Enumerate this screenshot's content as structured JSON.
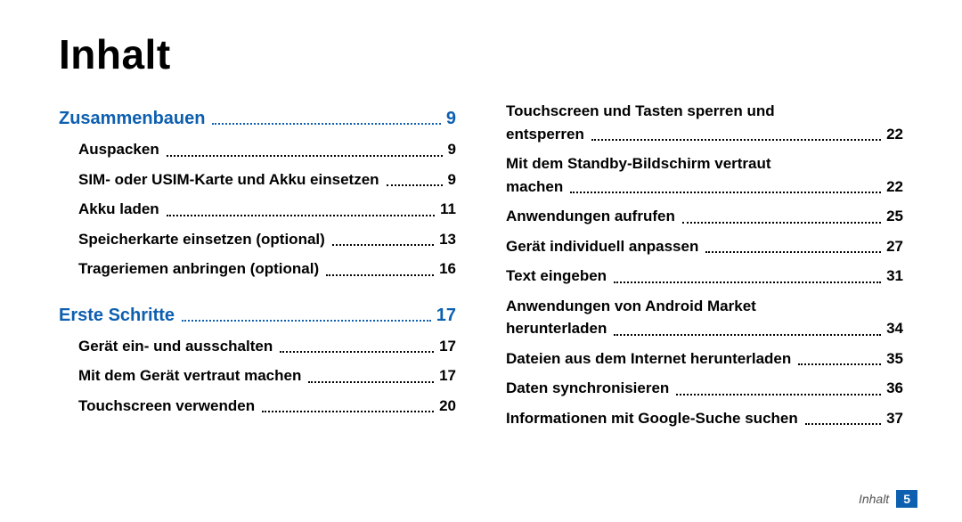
{
  "title": "Inhalt",
  "accent": "#0d5fb0",
  "columns": [
    [
      {
        "type": "section",
        "label": "Zusammenbauen",
        "page": "9"
      },
      {
        "type": "entry",
        "label": "Auspacken",
        "page": "9"
      },
      {
        "type": "entry",
        "label": "SIM- oder USIM-Karte und Akku einsetzen",
        "page": "9"
      },
      {
        "type": "entry",
        "label": "Akku laden",
        "page": "11"
      },
      {
        "type": "entry",
        "label": "Speicherkarte einsetzen (optional)",
        "page": "13"
      },
      {
        "type": "entry",
        "label": "Trageriemen anbringen (optional)",
        "page": "16"
      },
      {
        "type": "section",
        "label": "Erste Schritte",
        "page": "17"
      },
      {
        "type": "entry",
        "label": "Gerät ein- und ausschalten",
        "page": "17"
      },
      {
        "type": "entry",
        "label": "Mit dem Gerät vertraut machen",
        "page": "17"
      },
      {
        "type": "entry",
        "label": "Touchscreen verwenden",
        "page": "20"
      }
    ],
    [
      {
        "type": "entry",
        "lines": [
          "Touchscreen und Tasten sperren und",
          "entsperren"
        ],
        "page": "22"
      },
      {
        "type": "entry",
        "lines": [
          "Mit dem Standby-Bildschirm vertraut",
          "machen"
        ],
        "page": "22"
      },
      {
        "type": "entry",
        "label": "Anwendungen aufrufen",
        "page": "25"
      },
      {
        "type": "entry",
        "label": "Gerät individuell anpassen",
        "page": "27"
      },
      {
        "type": "entry",
        "label": "Text eingeben",
        "page": "31"
      },
      {
        "type": "entry",
        "lines": [
          "Anwendungen von Android Market",
          "herunterladen"
        ],
        "page": "34"
      },
      {
        "type": "entry",
        "label": "Dateien aus dem Internet herunterladen",
        "page": "35"
      },
      {
        "type": "entry",
        "label": "Daten synchronisieren",
        "page": "36"
      },
      {
        "type": "entry",
        "label": "Informationen mit Google-Suche suchen",
        "page": "37"
      }
    ]
  ],
  "footer": {
    "label": "Inhalt",
    "page": "5"
  }
}
